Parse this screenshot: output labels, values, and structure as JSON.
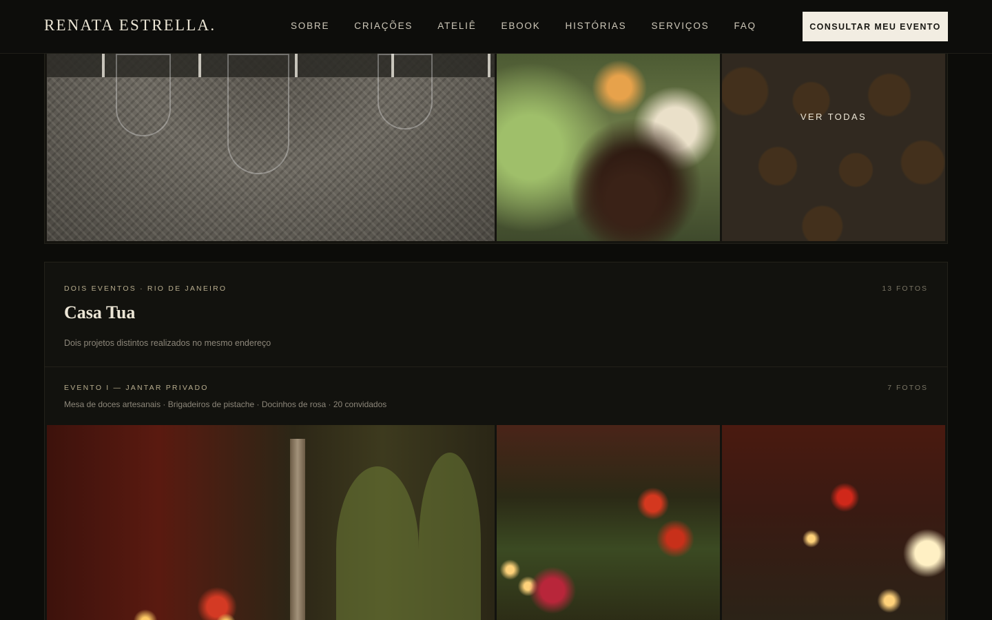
{
  "header": {
    "brand": "RENATA ESTRELLA.",
    "nav": [
      {
        "label": "SOBRE"
      },
      {
        "label": "CRIAÇÕES"
      },
      {
        "label": "ATELIÊ"
      },
      {
        "label": "EBOOK"
      },
      {
        "label": "HISTÓRIAS"
      },
      {
        "label": "SERVIÇOS"
      },
      {
        "label": "FAQ"
      }
    ],
    "cta_label": "CONSULTAR MEU EVENTO"
  },
  "gallery_top": {
    "see_all_label": "VER TODAS"
  },
  "card": {
    "eyebrow": "DOIS EVENTOS · RIO DE JANEIRO",
    "photo_count": "13 FOTOS",
    "title": "Casa Tua",
    "description": "Dois projetos distintos realizados no mesmo endereço",
    "event": {
      "eyebrow": "EVENTO I — JANTAR PRIVADO",
      "photo_count": "7 FOTOS",
      "description": "Mesa de doces artesanais · Brigadeiros de pistache · Docinhos de rosa · 20 convidados"
    }
  }
}
